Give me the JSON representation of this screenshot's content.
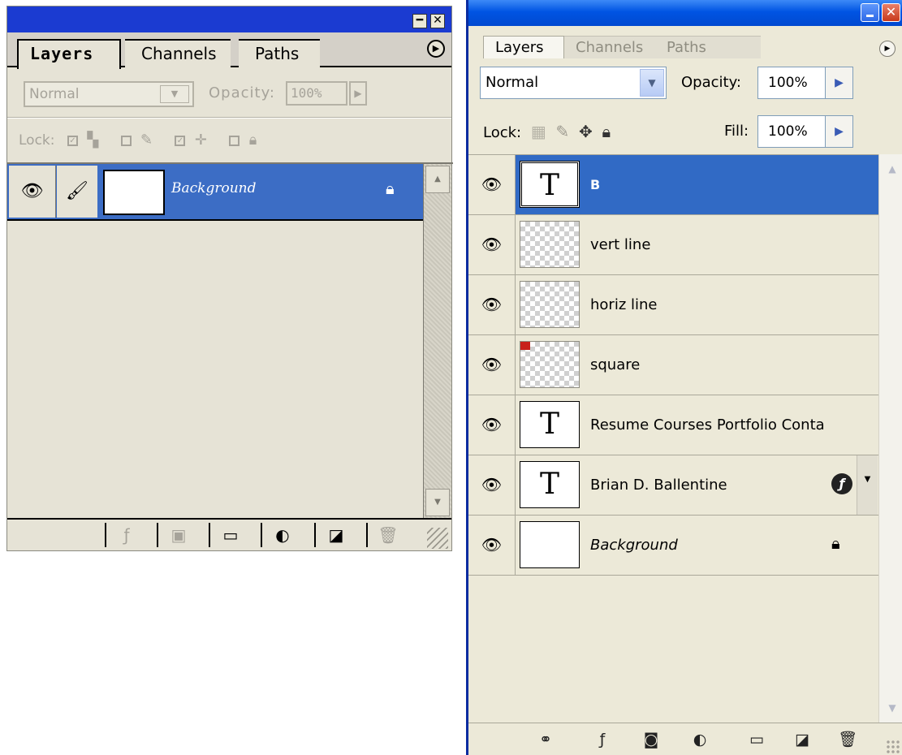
{
  "left_panel": {
    "title_buttons": {
      "minimize": "━",
      "close": "✕"
    },
    "tabs": [
      {
        "label": "Layers",
        "active": true
      },
      {
        "label": "Channels",
        "active": false
      },
      {
        "label": "Paths",
        "active": false
      }
    ],
    "blend_mode": "Normal",
    "opacity_label": "Opacity:",
    "opacity_value": "100%",
    "lock_label": "Lock:",
    "layers": [
      {
        "name": "Background",
        "locked": true,
        "selected": true
      }
    ],
    "footer_icons": [
      "fx-icon",
      "mask-icon",
      "folder-icon",
      "adjustment-icon",
      "new-layer-icon",
      "trash-icon"
    ]
  },
  "right_panel": {
    "tabs": [
      {
        "label": "Layers",
        "active": true
      },
      {
        "label": "Channels",
        "active": false
      },
      {
        "label": "Paths",
        "active": false
      }
    ],
    "blend_mode": "Normal",
    "opacity_label": "Opacity:",
    "opacity_value": "100%",
    "lock_label": "Lock:",
    "fill_label": "Fill:",
    "fill_value": "100%",
    "layers": [
      {
        "name": "B",
        "thumb": "T",
        "type": "text",
        "selected": true
      },
      {
        "name": "vert line",
        "thumb": "",
        "type": "raster"
      },
      {
        "name": "horiz line",
        "thumb": "",
        "type": "raster"
      },
      {
        "name": "square",
        "thumb": "",
        "type": "raster-red"
      },
      {
        "name": "Resume Courses Portfolio Conta",
        "thumb": "T",
        "type": "text"
      },
      {
        "name": "Brian D. Ballentine",
        "thumb": "T",
        "type": "text",
        "effects": true
      },
      {
        "name": "Background",
        "thumb": "",
        "type": "background",
        "locked": true
      }
    ]
  },
  "colors": {
    "left_titlebar": "#1b3bd1",
    "selection": "#316ac5",
    "panel_bg": "#ece9d8"
  }
}
